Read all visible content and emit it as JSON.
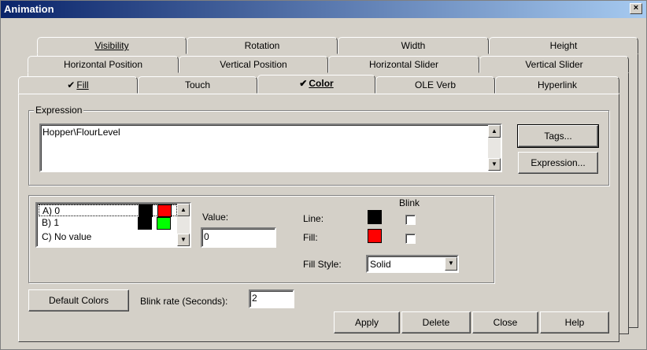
{
  "window": {
    "title": "Animation",
    "close_glyph": "×"
  },
  "tabs": {
    "row1": [
      {
        "label": "Visibility"
      },
      {
        "label": "Rotation"
      },
      {
        "label": "Width"
      },
      {
        "label": "Height"
      }
    ],
    "row2": [
      {
        "label": "Horizontal Position"
      },
      {
        "label": "Vertical Position"
      },
      {
        "label": "Horizontal Slider"
      },
      {
        "label": "Vertical Slider"
      }
    ],
    "row3": [
      {
        "label": "Fill",
        "checked": true
      },
      {
        "label": "Touch"
      },
      {
        "label": "Color",
        "checked": true,
        "active": true
      },
      {
        "label": "OLE Verb"
      },
      {
        "label": "Hyperlink"
      }
    ],
    "check_glyph": "✔"
  },
  "expression": {
    "group_label": "Expression",
    "value": "Hopper\\FlourLevel",
    "tags_button": "Tags...",
    "expression_button": "Expression..."
  },
  "color_list": {
    "items": [
      {
        "label": "A) 0",
        "line_color": "#000000",
        "fill_color": "#ff0000",
        "selected": true
      },
      {
        "label": "B) 1",
        "line_color": "#000000",
        "fill_color": "#00ff00"
      },
      {
        "label": "C) No value"
      }
    ]
  },
  "value_field": {
    "label": "Value:",
    "value": "0"
  },
  "blink_header": "Blink",
  "line_row": {
    "label": "Line:",
    "color": "#000000",
    "blink": false
  },
  "fill_row": {
    "label": "Fill:",
    "color": "#ff0000",
    "blink": false
  },
  "fill_style": {
    "label": "Fill Style:",
    "value": "Solid"
  },
  "default_colors_button": "Default Colors",
  "blink_rate": {
    "label": "Blink rate (Seconds):",
    "value": "2"
  },
  "footer_buttons": {
    "apply": "Apply",
    "delete": "Delete",
    "close": "Close",
    "help": "Help"
  }
}
